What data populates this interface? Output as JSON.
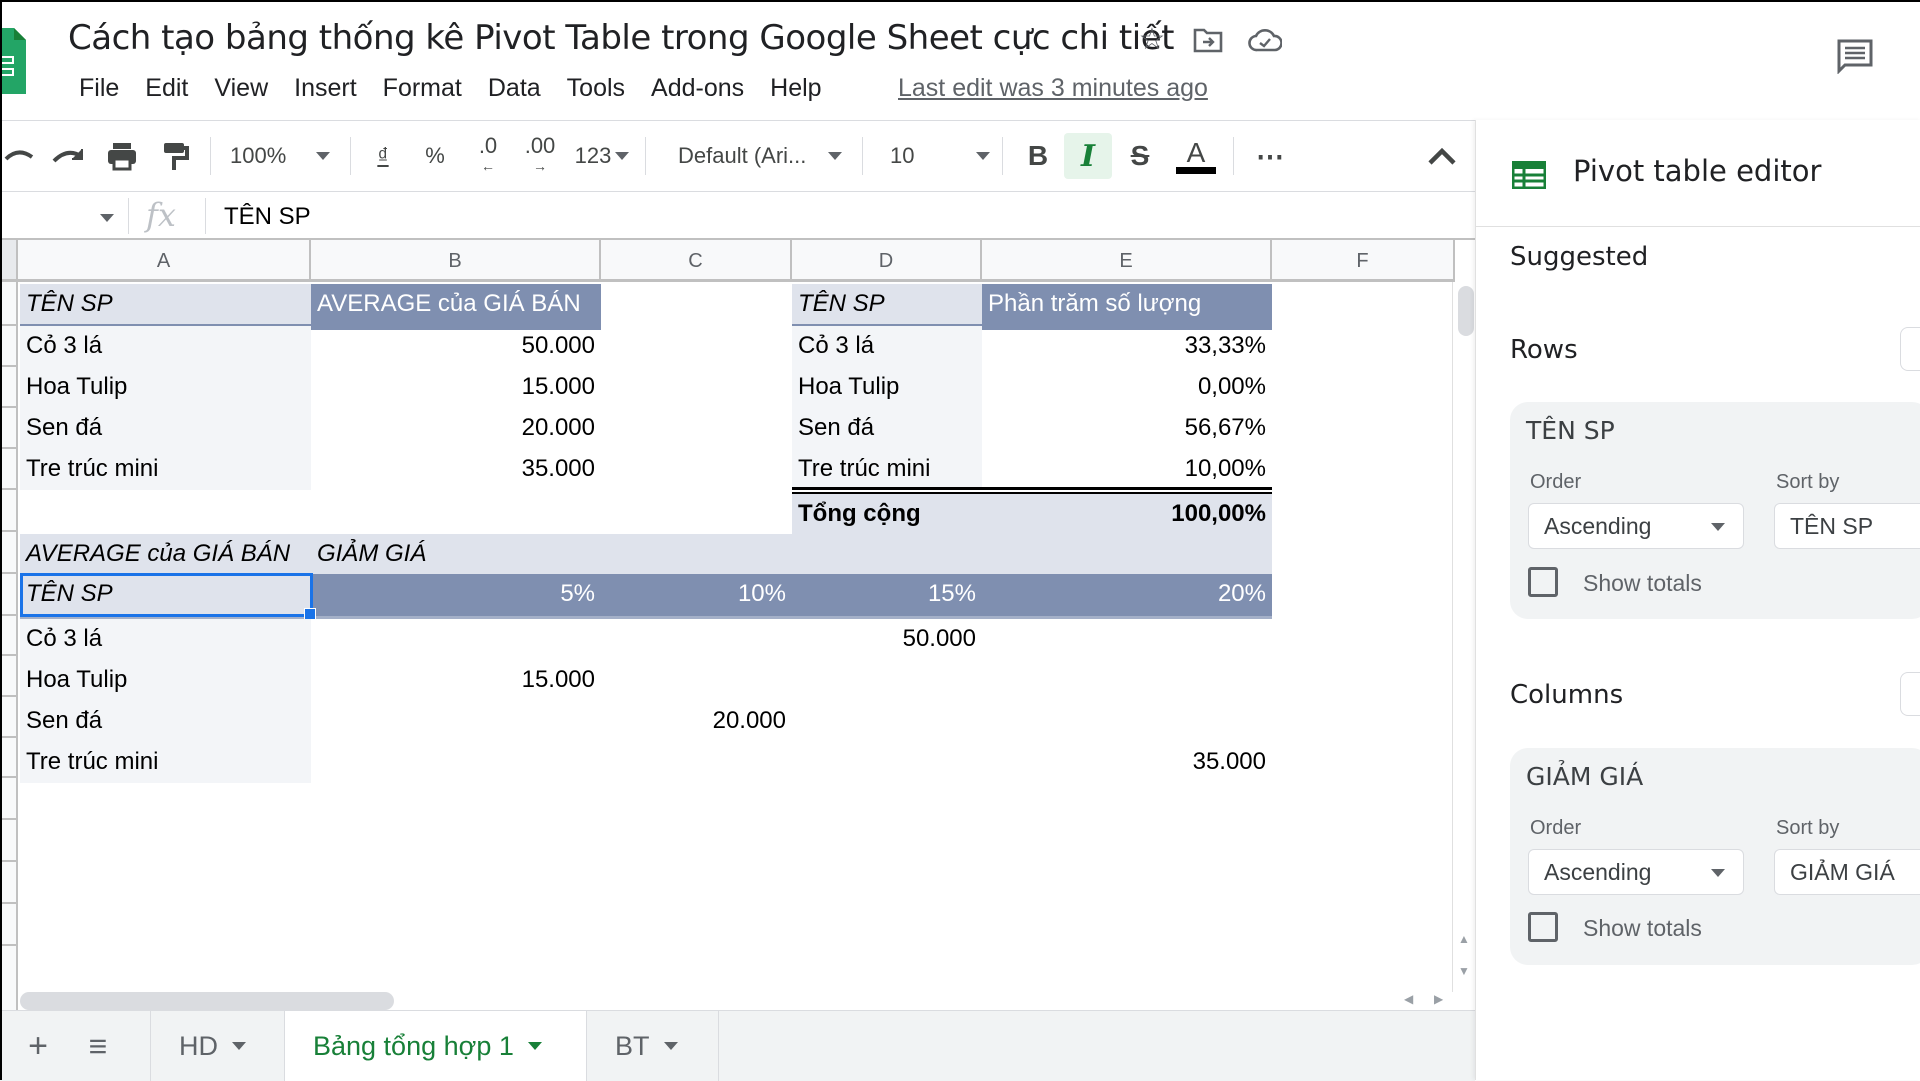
{
  "app": {
    "document_title": "Cách tạo bảng thống kê Pivot Table trong Google Sheet cực chi tiết",
    "menu": [
      "File",
      "Edit",
      "View",
      "Insert",
      "Format",
      "Data",
      "Tools",
      "Add-ons",
      "Help"
    ],
    "last_edit": "Last edit was 3 minutes ago",
    "accent_color": "#188038",
    "icons": {
      "star": "star-icon",
      "move": "move-to-folder-icon",
      "cloud": "cloud-saved-icon",
      "comments": "comments-icon"
    }
  },
  "toolbar": {
    "zoom": "100%",
    "currency": "₫",
    "percent": "%",
    "decrease_decimal": ".0",
    "increase_decimal": ".00",
    "more_formats": "123",
    "font": "Default (Ari...",
    "font_size": "10",
    "bold": "B",
    "italic": "I",
    "strikethrough": "S",
    "text_color": "A",
    "more": "⋯",
    "italic_active": true
  },
  "formula_bar": {
    "fx_label": "fx",
    "value": "TÊN SP"
  },
  "grid": {
    "columns": [
      "A",
      "B",
      "C",
      "D",
      "E",
      "F"
    ],
    "pivot1": {
      "header_row": "TÊN SP",
      "header_value": "AVERAGE của GIÁ BÁN",
      "rows": [
        {
          "name": "Cỏ 3 lá",
          "value": "50.000"
        },
        {
          "name": "Hoa Tulip",
          "value": "15.000"
        },
        {
          "name": "Sen đá",
          "value": "20.000"
        },
        {
          "name": "Tre trúc mini",
          "value": "35.000"
        }
      ]
    },
    "pivot2": {
      "header_row": "TÊN SP",
      "header_value": "Phần trăm số lượng",
      "rows": [
        {
          "name": "Cỏ 3 lá",
          "value": "33,33%"
        },
        {
          "name": "Hoa Tulip",
          "value": "0,00%"
        },
        {
          "name": "Sen đá",
          "value": "56,67%"
        },
        {
          "name": "Tre trúc mini",
          "value": "10,00%"
        }
      ],
      "total_label": "Tổng cộng",
      "total_value": "100,00%"
    },
    "pivot3": {
      "value_label": "AVERAGE của GIÁ BÁN",
      "column_field": "GIẢM GIÁ",
      "row_field": "TÊN SP",
      "column_headers": [
        "5%",
        "10%",
        "15%",
        "20%"
      ],
      "rows": [
        {
          "name": "Cỏ 3 lá",
          "values": [
            "",
            "",
            "50.000",
            ""
          ]
        },
        {
          "name": "Hoa Tulip",
          "values": [
            "15.000",
            "",
            "",
            ""
          ]
        },
        {
          "name": "Sen đá",
          "values": [
            "",
            "20.000",
            "",
            ""
          ]
        },
        {
          "name": "Tre trúc mini",
          "values": [
            "",
            "",
            "",
            "35.000"
          ]
        }
      ]
    }
  },
  "sheet_tabs": {
    "add": "+",
    "all_sheets": "≡",
    "tabs": [
      {
        "label": "HD",
        "active": false
      },
      {
        "label": "Bảng tổng hợp 1",
        "active": true
      },
      {
        "label": "BT",
        "active": false
      }
    ]
  },
  "pivot_editor": {
    "title": "Pivot table editor",
    "suggested": "Suggested",
    "rows_label": "Rows",
    "columns_label": "Columns",
    "row_field": {
      "name": "TÊN SP",
      "order_label": "Order",
      "order_value": "Ascending",
      "sort_by_label": "Sort by",
      "sort_by_value": "TÊN SP",
      "show_totals_label": "Show totals",
      "show_totals": false
    },
    "column_field": {
      "name": "GIẢM GIÁ",
      "order_label": "Order",
      "order_value": "Ascending",
      "sort_by_label": "Sort by",
      "sort_by_value": "GIẢM GIÁ",
      "show_totals_label": "Show totals",
      "show_totals": false
    }
  }
}
